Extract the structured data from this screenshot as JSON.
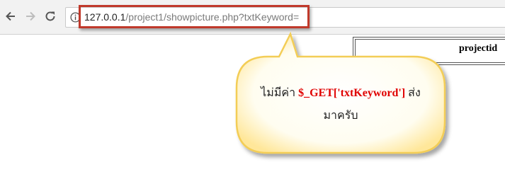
{
  "browser": {
    "back_icon": "arrow-left-icon",
    "forward_icon": "arrow-right-icon",
    "reload_icon": "reload-icon",
    "info_icon": "info-icon",
    "url_host": "127.0.0.1",
    "url_path": "/project1/showpicture.php?txtKeyword="
  },
  "table": {
    "header": "projectid"
  },
  "callout": {
    "text_before": "ไม่มีค่า ",
    "code": "$_GET['txtKeyword']",
    "text_after": " ส่ง",
    "line2": "มาครับ"
  },
  "colors": {
    "highlight_border": "#c0392b",
    "callout_fill": "#fffef2",
    "callout_border": "#f5d060",
    "code_color": "#e00000"
  }
}
